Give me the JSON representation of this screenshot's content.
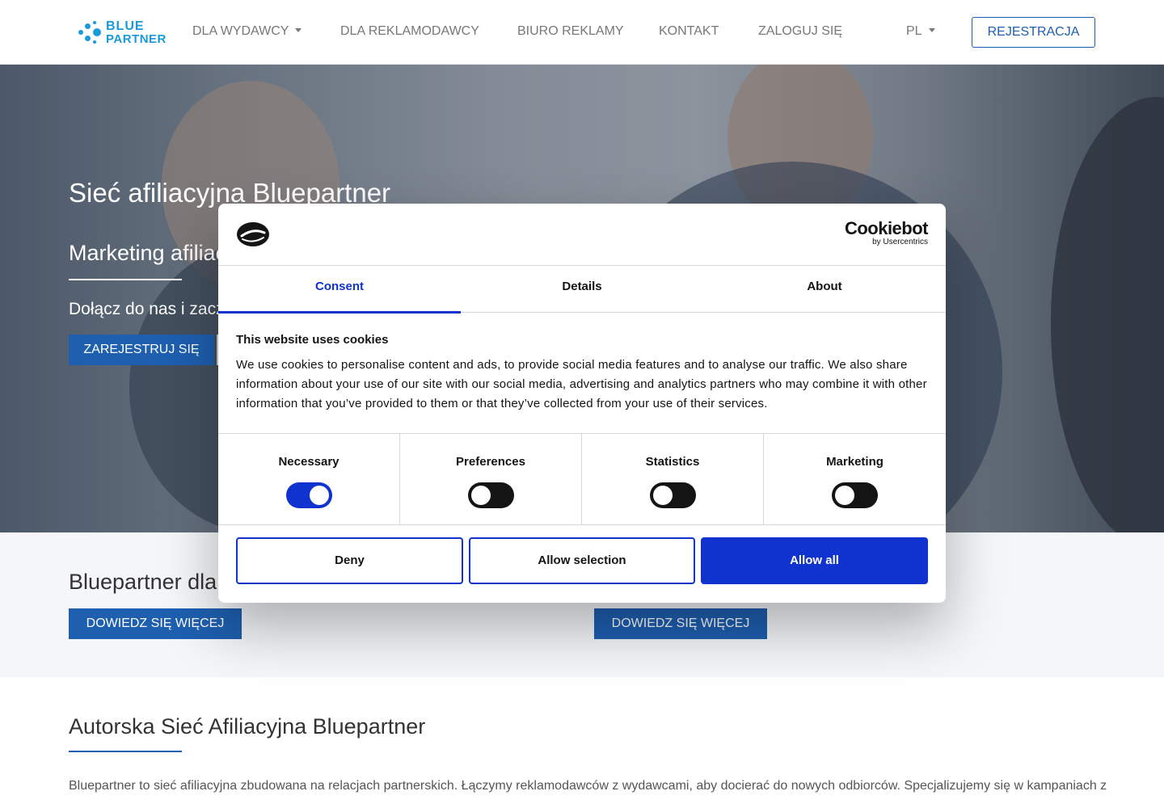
{
  "nav": {
    "logo_line1": "BLUE",
    "logo_line2": "PARTNER",
    "items": [
      {
        "label": "DLA WYDAWCY",
        "dropdown": true
      },
      {
        "label": "DLA REKLAMODAWCY",
        "dropdown": false
      },
      {
        "label": "BIURO REKLAMY",
        "dropdown": false
      },
      {
        "label": "KONTAKT",
        "dropdown": false
      },
      {
        "label": "ZALOGUJ SIĘ",
        "dropdown": false
      }
    ],
    "language": "PL",
    "register_button": "REJESTRACJA",
    "accent_color": "#1e5fb0"
  },
  "hero": {
    "title": "Sieć afiliacyjna Bluepartner",
    "subtitle": "Marketing afiliac",
    "text": "Dołącz do nas i zacz",
    "cta": "ZAREJESTRUJ SIĘ"
  },
  "section2": {
    "heading": "Bluepartner dla W",
    "button_left": "DOWIEDZ SIĘ WIĘCEJ",
    "button_right": "DOWIEDZ SIĘ WIĘCEJ"
  },
  "section3": {
    "title": "Autorska Sieć Afiliacyjna Bluepartner",
    "text": "Bluepartner to sieć afiliacyjna zbudowana na relacjach partnerskich. Łączymy reklamodawców z wydawcami, aby docierać do nowych odbiorców. Specjalizujemy się w kampaniach z"
  },
  "cookie": {
    "brand": "Cookiebot",
    "brand_sub": "by Usercentrics",
    "tabs": [
      "Consent",
      "Details",
      "About"
    ],
    "active_tab": "Consent",
    "title": "This website uses cookies",
    "text": "We use cookies to personalise content and ads, to provide social media features and to analyse our traffic. We also share information about your use of our site with our social media, advertising and analytics partners who may combine it with other information that you’ve provided to them or that they’ve collected from your use of their services.",
    "categories": [
      {
        "label": "Necessary",
        "enabled": true
      },
      {
        "label": "Preferences",
        "enabled": false
      },
      {
        "label": "Statistics",
        "enabled": false
      },
      {
        "label": "Marketing",
        "enabled": false
      }
    ],
    "buttons": {
      "deny": "Deny",
      "allow_selection": "Allow selection",
      "allow_all": "Allow all"
    },
    "accent_color": "#1032cf"
  }
}
